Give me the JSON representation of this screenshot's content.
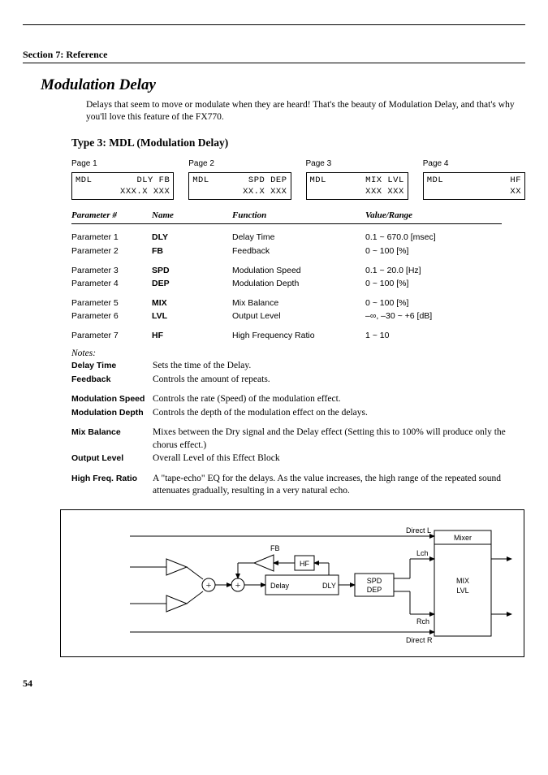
{
  "section": "Section 7: Reference",
  "title": "Modulation Delay",
  "intro": "Delays that seem to move or modulate when they are heard! That's the beauty of Modulation Delay, and that's why you'll love this feature of the FX770.",
  "subtitle": "Type 3: MDL (Modulation Delay)",
  "pages": {
    "p1": {
      "label": "Page 1",
      "row1a": "MDL",
      "row1b": "DLY  FB",
      "row2": "XXX.X XXX"
    },
    "p2": {
      "label": "Page 2",
      "row1a": "MDL",
      "row1b": "SPD DEP",
      "row2": "XX.X XXX"
    },
    "p3": {
      "label": "Page 3",
      "row1a": "MDL",
      "row1b": "MIX LVL",
      "row2": "XXX XXX"
    },
    "p4": {
      "label": "Page 4",
      "row1a": "MDL",
      "row1b": "HF",
      "row2": "XX"
    }
  },
  "th": {
    "num": "Parameter #",
    "name": "Name",
    "func": "Function",
    "range": "Value/Range"
  },
  "params": {
    "r1": {
      "num": "Parameter 1",
      "name": "DLY",
      "func": "Delay Time",
      "range": "0.1 ~ 670.0 [msec]"
    },
    "r2": {
      "num": "Parameter 2",
      "name": "FB",
      "func": "Feedback",
      "range": "0 ~ 100 [%]"
    },
    "r3": {
      "num": "Parameter 3",
      "name": "SPD",
      "func": "Modulation Speed",
      "range": "0.1 ~ 20.0 [Hz]"
    },
    "r4": {
      "num": "Parameter 4",
      "name": "DEP",
      "func": "Modulation Depth",
      "range": "0 ~ 100 [%]"
    },
    "r5": {
      "num": "Parameter 5",
      "name": "MIX",
      "func": "Mix Balance",
      "range": "0 ~ 100 [%]"
    },
    "r6": {
      "num": "Parameter 6",
      "name": "LVL",
      "func": "Output Level",
      "range": "–∞, –30 ~ +6 [dB]"
    },
    "r7": {
      "num": "Parameter 7",
      "name": "HF",
      "func": "High Frequency Ratio",
      "range": "1 ~ 10"
    }
  },
  "notes": {
    "head": "Notes:",
    "n1": {
      "lab": "Delay Time",
      "desc": "Sets the time of the Delay."
    },
    "n2": {
      "lab": "Feedback",
      "desc": "Controls the amount of repeats."
    },
    "n3": {
      "lab": "Modulation Speed",
      "desc": "Controls the rate (Speed) of the modulation effect."
    },
    "n4": {
      "lab": "Modulation Depth",
      "desc": "Controls the depth of the modulation effect on the delays."
    },
    "n5": {
      "lab": "Mix Balance",
      "desc": "Mixes between the Dry signal and the Delay effect (Setting this to 100% will produce only the chorus effect.)"
    },
    "n6": {
      "lab": "Output Level",
      "desc": "Overall Level of this Effect Block"
    },
    "n7": {
      "lab": "High Freq. Ratio",
      "desc": "A \"tape-echo\" EQ for the delays. As the value increases, the high range of the repeated sound attenuates gradually, resulting in a very natural echo."
    }
  },
  "diag": {
    "directL": "Direct L",
    "directR": "Direct R",
    "mixer": "Mixer",
    "mix": "MIX",
    "lvl": "LVL",
    "fb": "FB",
    "hf": "HF",
    "delay": "Delay",
    "dly": "DLY",
    "spd": "SPD",
    "dep": "DEP",
    "lch": "Lch",
    "rch": "Rch"
  },
  "pagenum": "54"
}
